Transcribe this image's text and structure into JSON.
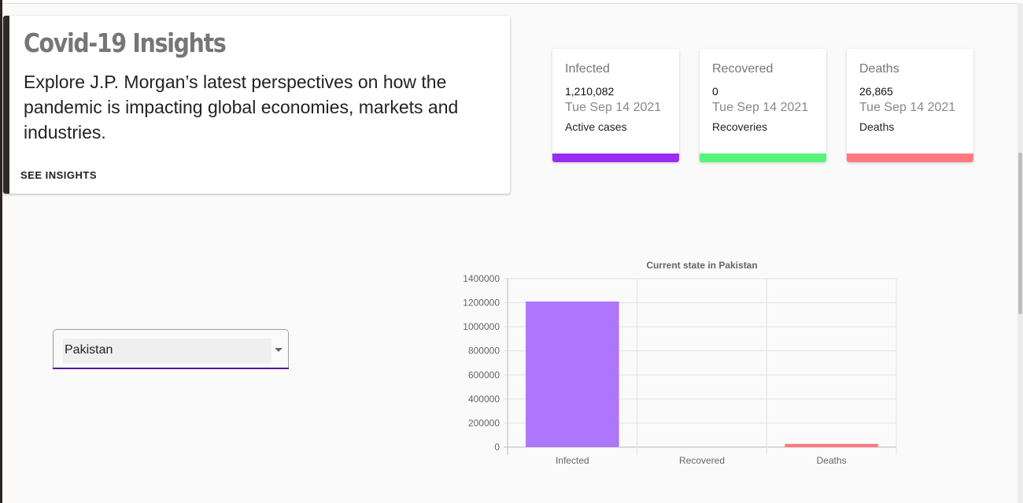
{
  "insights": {
    "title": "Covid-19 Insights",
    "body": "Explore J.P. Morgan’s latest perspectives on how the pandemic is impacting global economies, markets and industries.",
    "link": "SEE INSIGHTS"
  },
  "stats": [
    {
      "label": "Infected",
      "value": "1,210,082",
      "date": "Tue Sep 14 2021",
      "caption": "Active cases",
      "color": "#9b2cf3"
    },
    {
      "label": "Recovered",
      "value": "0",
      "date": "Tue Sep 14 2021",
      "caption": "Recoveries",
      "color": "#55f57a"
    },
    {
      "label": "Deaths",
      "value": "26,865",
      "date": "Tue Sep 14 2021",
      "caption": "Deaths",
      "color": "#ff7a7e"
    }
  ],
  "country_select": {
    "value": "Pakistan"
  },
  "chart_data": {
    "type": "bar",
    "title": "Current state in Pakistan",
    "categories": [
      "Infected",
      "Recovered",
      "Deaths"
    ],
    "values": [
      1210082,
      0,
      26865
    ],
    "colors": [
      "#ae76fa",
      "#55f57a",
      "#ff7a7e"
    ],
    "ylim": [
      0,
      1400000
    ],
    "yticks": [
      0,
      200000,
      400000,
      600000,
      800000,
      1000000,
      1200000,
      1400000
    ],
    "grid": true
  }
}
